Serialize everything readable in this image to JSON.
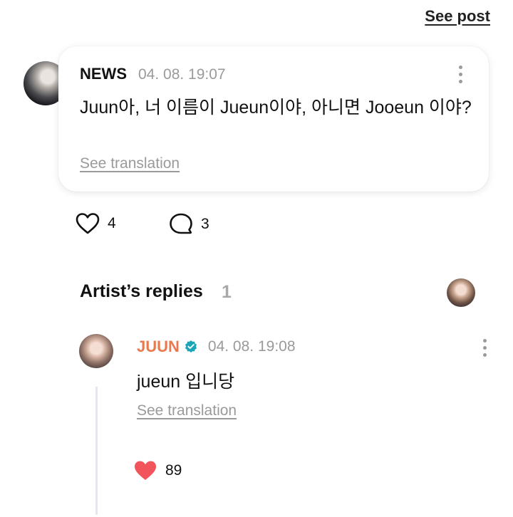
{
  "header": {
    "see_post_label": "See post"
  },
  "post": {
    "author": "NEWS",
    "timestamp": "04. 08. 19:07",
    "text": "Juun아, 너 이름이 Jueun이야, 아니면 Jooeun 이야?",
    "see_translation_label": "See translation",
    "like_count": "4",
    "comment_count": "3"
  },
  "artist_replies": {
    "title": "Artist’s replies",
    "count": "1",
    "items": [
      {
        "author": "JUUN",
        "verified": true,
        "timestamp": "04. 08. 19:08",
        "text": "jueun 입니당",
        "see_translation_label": "See translation",
        "like_count": "89"
      }
    ]
  },
  "colors": {
    "artist_name": "#ea7a4e",
    "verified_badge": "#1aa6b7",
    "heart_filled": "#f2545b",
    "muted_text": "#9a9a9a"
  }
}
